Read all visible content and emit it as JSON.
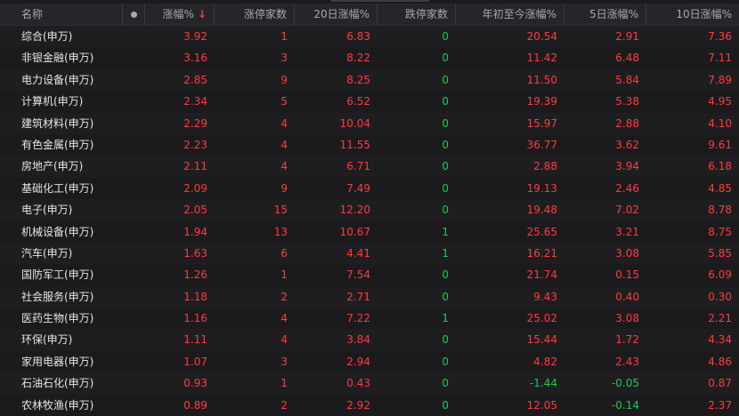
{
  "header": {
    "name": "名称",
    "change_pct": "涨幅%",
    "sort_arrow": "↓",
    "limit_up_count": "涨停家数",
    "change_20d": "20日涨幅%",
    "limit_down_count": "跌停家数",
    "ytd_change": "年初至今涨幅%",
    "change_5d": "5日涨幅%",
    "change_10d": "10日涨幅%"
  },
  "colors": {
    "up": "#ff3c3c",
    "down": "#1ec94e",
    "name": "#e6e6e6"
  },
  "rows": [
    {
      "name": "综合(申万)",
      "change": "3.92",
      "limit_up": "1",
      "change_20d": "6.83",
      "limit_down": "0",
      "ytd": "20.54",
      "change_5d": "2.91",
      "change_10d": "7.36"
    },
    {
      "name": "非银金融(申万)",
      "change": "3.16",
      "limit_up": "3",
      "change_20d": "8.22",
      "limit_down": "0",
      "ytd": "11.42",
      "change_5d": "6.48",
      "change_10d": "7.11"
    },
    {
      "name": "电力设备(申万)",
      "change": "2.85",
      "limit_up": "9",
      "change_20d": "8.25",
      "limit_down": "0",
      "ytd": "11.50",
      "change_5d": "5.84",
      "change_10d": "7.89"
    },
    {
      "name": "计算机(申万)",
      "change": "2.34",
      "limit_up": "5",
      "change_20d": "6.52",
      "limit_down": "0",
      "ytd": "19.39",
      "change_5d": "5.38",
      "change_10d": "4.95"
    },
    {
      "name": "建筑材料(申万)",
      "change": "2.29",
      "limit_up": "4",
      "change_20d": "10.04",
      "limit_down": "0",
      "ytd": "15.97",
      "change_5d": "2.88",
      "change_10d": "4.10"
    },
    {
      "name": "有色金属(申万)",
      "change": "2.23",
      "limit_up": "4",
      "change_20d": "11.55",
      "limit_down": "0",
      "ytd": "36.77",
      "change_5d": "3.62",
      "change_10d": "9.61"
    },
    {
      "name": "房地产(申万)",
      "change": "2.11",
      "limit_up": "4",
      "change_20d": "6.71",
      "limit_down": "0",
      "ytd": "2.88",
      "change_5d": "3.94",
      "change_10d": "6.18"
    },
    {
      "name": "基础化工(申万)",
      "change": "2.09",
      "limit_up": "9",
      "change_20d": "7.49",
      "limit_down": "0",
      "ytd": "19.13",
      "change_5d": "2.46",
      "change_10d": "4.85"
    },
    {
      "name": "电子(申万)",
      "change": "2.05",
      "limit_up": "15",
      "change_20d": "12.20",
      "limit_down": "0",
      "ytd": "19.48",
      "change_5d": "7.02",
      "change_10d": "8.78"
    },
    {
      "name": "机械设备(申万)",
      "change": "1.94",
      "limit_up": "13",
      "change_20d": "10.67",
      "limit_down": "1",
      "ytd": "25.65",
      "change_5d": "3.21",
      "change_10d": "8.75"
    },
    {
      "name": "汽车(申万)",
      "change": "1.63",
      "limit_up": "6",
      "change_20d": "4.41",
      "limit_down": "1",
      "ytd": "16.21",
      "change_5d": "3.08",
      "change_10d": "5.85"
    },
    {
      "name": "国防军工(申万)",
      "change": "1.26",
      "limit_up": "1",
      "change_20d": "7.54",
      "limit_down": "0",
      "ytd": "21.74",
      "change_5d": "0.15",
      "change_10d": "6.09"
    },
    {
      "name": "社会服务(申万)",
      "change": "1.18",
      "limit_up": "2",
      "change_20d": "2.71",
      "limit_down": "0",
      "ytd": "9.43",
      "change_5d": "0.40",
      "change_10d": "0.30"
    },
    {
      "name": "医药生物(申万)",
      "change": "1.16",
      "limit_up": "4",
      "change_20d": "7.22",
      "limit_down": "1",
      "ytd": "25.02",
      "change_5d": "3.08",
      "change_10d": "2.21"
    },
    {
      "name": "环保(申万)",
      "change": "1.11",
      "limit_up": "4",
      "change_20d": "3.84",
      "limit_down": "0",
      "ytd": "15.44",
      "change_5d": "1.72",
      "change_10d": "4.34"
    },
    {
      "name": "家用电器(申万)",
      "change": "1.07",
      "limit_up": "3",
      "change_20d": "2.94",
      "limit_down": "0",
      "ytd": "4.82",
      "change_5d": "2.43",
      "change_10d": "4.86"
    },
    {
      "name": "石油石化(申万)",
      "change": "0.93",
      "limit_up": "1",
      "change_20d": "0.43",
      "limit_down": "0",
      "ytd": "-1.44",
      "change_5d": "-0.05",
      "change_10d": "0.87"
    },
    {
      "name": "农林牧渔(申万)",
      "change": "0.89",
      "limit_up": "2",
      "change_20d": "2.92",
      "limit_down": "0",
      "ytd": "12.05",
      "change_5d": "-0.14",
      "change_10d": "2.37"
    }
  ]
}
